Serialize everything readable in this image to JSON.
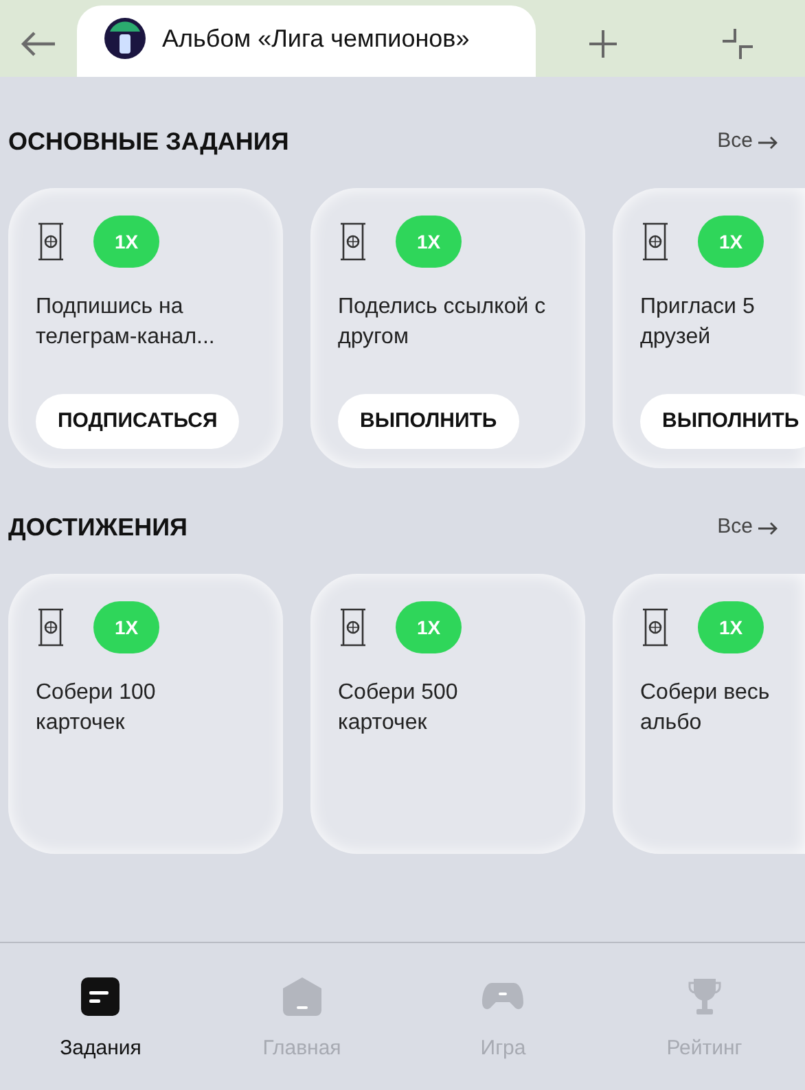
{
  "tab": {
    "title": "Альбом «Лига чемпионов»"
  },
  "sections": [
    {
      "title": "ОСНОВНЫЕ ЗАДАНИЯ",
      "link": "Все",
      "cards": [
        {
          "badge": "1X",
          "text": "Подпишись на телеграм-канал...",
          "button": "ПОДПИСАТЬСЯ"
        },
        {
          "badge": "1X",
          "text": "Поделись ссылкой с другом",
          "button": "ВЫПОЛНИТЬ"
        },
        {
          "badge": "1X",
          "text": "Пригласи 5 друзей",
          "button": "ВЫПОЛНИТЬ"
        }
      ]
    },
    {
      "title": "ДОСТИЖЕНИЯ",
      "link": "Все",
      "cards": [
        {
          "badge": "1X",
          "text": "Собери 100 карточек"
        },
        {
          "badge": "1X",
          "text": "Собери 500 карточек"
        },
        {
          "badge": "1X",
          "text": "Собери весь альбо"
        }
      ]
    }
  ],
  "nav": [
    {
      "kind": "tasks",
      "label": "Задания",
      "selected": true
    },
    {
      "kind": "home",
      "label": "Главная",
      "selected": false
    },
    {
      "kind": "game",
      "label": "Игра",
      "selected": false
    },
    {
      "kind": "rating",
      "label": "Рейтинг",
      "selected": false
    }
  ]
}
